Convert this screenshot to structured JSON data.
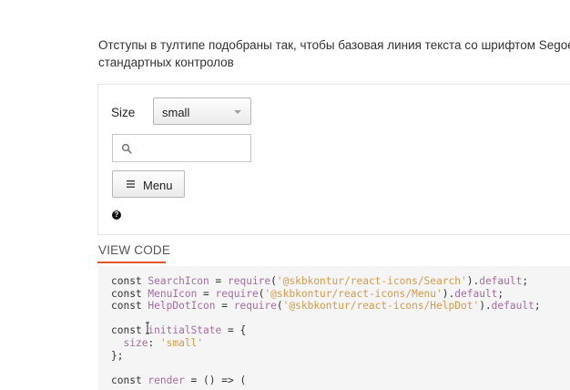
{
  "description": {
    "line1": "Отступы в тултипе подобраны так, чтобы базовая линия текста со шрифтом Segoe U",
    "line2": "стандартных контролов"
  },
  "demo": {
    "size_label": "Size",
    "size_select_value": "small",
    "search_value": "",
    "menu_button_label": "Menu",
    "help_icon_glyph": "?"
  },
  "view_code": {
    "label": "VIEW CODE"
  },
  "code": {
    "lines": [
      [
        "const ",
        "SearchIcon",
        " = ",
        "require",
        "(",
        "'@skbkontur/react-icons/Search'",
        ").",
        "default",
        ";"
      ],
      [
        "const ",
        "MenuIcon",
        " = ",
        "require",
        "(",
        "'@skbkontur/react-icons/Menu'",
        ").",
        "default",
        ";"
      ],
      [
        "const ",
        "HelpDotIcon",
        " = ",
        "require",
        "(",
        "'@skbkontur/react-icons/HelpDot'",
        ").",
        "default",
        ";"
      ],
      [
        "const ",
        "initialState",
        " = {"
      ],
      [
        "  ",
        "size",
        ": ",
        "'small'"
      ],
      [
        "};"
      ],
      [
        "const ",
        "render",
        " = () => ("
      ]
    ]
  },
  "icons": {
    "search": "search-icon",
    "menu": "hamburger-menu-icon",
    "help": "help-dot-icon",
    "caret": "chevron-down-icon"
  },
  "colors": {
    "accent_underline": "#e05a2b",
    "code_identifier": "#a66da0",
    "code_string": "#d69a4a",
    "code_background": "#f5f5f5"
  }
}
